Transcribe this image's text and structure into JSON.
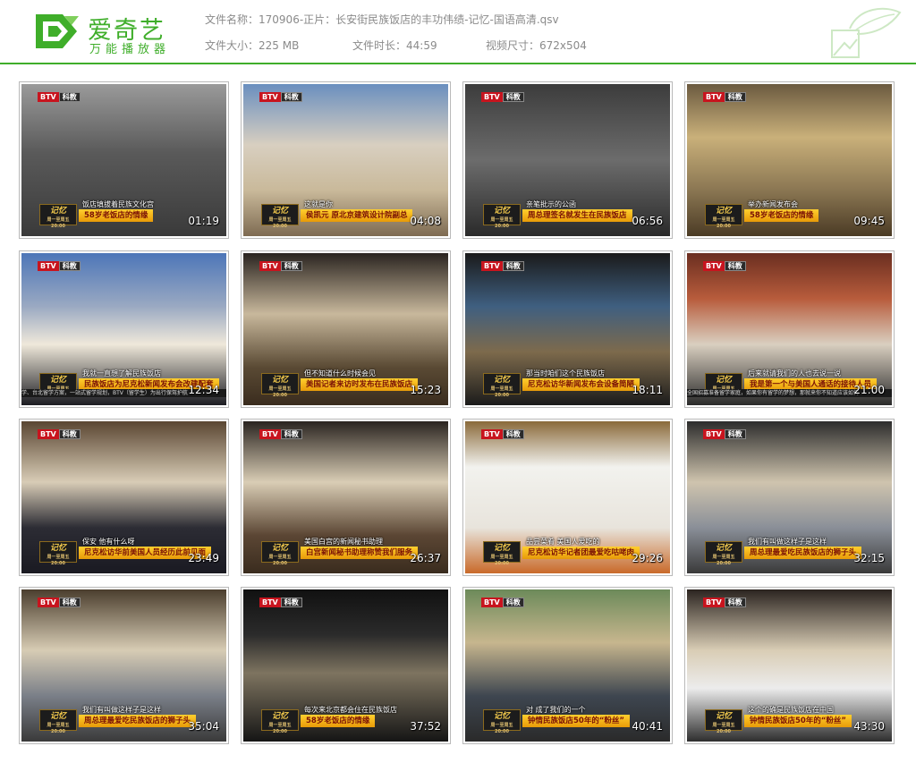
{
  "header": {
    "logo_title": "爱奇艺",
    "logo_subtitle": "万能播放器",
    "filename_label": "文件名称：",
    "filename": "170906-正片：长安街民族饭店的丰功伟绩-记忆-国语高清.qsv",
    "filesize_label": "文件大小：",
    "filesize": "225 MB",
    "duration_label": "文件时长：",
    "duration": "44:59",
    "dimensions_label": "视频尺寸：",
    "dimensions": "672x504"
  },
  "colors": {
    "brand_green": "#3fae2a",
    "caption_bar": "#f5b21a"
  },
  "channel_badge": {
    "left": "BTV",
    "right": "科教"
  },
  "show_logo": {
    "title": "记忆",
    "subtitle": "周一至周五 20:00"
  },
  "thumbnails": [
    {
      "caption_top": "饭店填拔着民族文化宫",
      "caption_bar": "58岁老饭店的情缘",
      "timestamp": "01:19",
      "ticker": ""
    },
    {
      "caption_top": "这就是你",
      "caption_bar": "侯凯元  原北京建筑设计院副总",
      "timestamp": "04:08",
      "ticker": ""
    },
    {
      "caption_top": "亲笔批示的公函",
      "caption_bar": "周总理签名就发生在民族饭店",
      "timestamp": "06:56",
      "ticker": ""
    },
    {
      "caption_top": "举办新闻发布会",
      "caption_bar": "58岁老饭店的情缘",
      "timestamp": "09:45",
      "ticker": ""
    },
    {
      "caption_top": "我就一直想了解民族饭店",
      "caption_bar": "民族饭店为尼克松新闻发布会改建配套",
      "timestamp": "12:34",
      "ticker": "学、台北留学方案，一站式留学规划，BTV（留学生）为出行保驾护航"
    },
    {
      "caption_top": "但不知道什么时候会见",
      "caption_bar": "美国记者来访时发布在民族饭店",
      "timestamp": "15:23",
      "ticker": ""
    },
    {
      "caption_top": "那当时咱们这个民族饭店",
      "caption_bar": "尼克松访华新闻发布会设备简陋",
      "timestamp": "18:11",
      "ticker": ""
    },
    {
      "caption_top": "后来就请我们的人也去说一说",
      "caption_bar": "我是第一个与美国人通话的接待人员",
      "timestamp": "21:00",
      "ticker": "全国招募准备留学家庭，如果你有留学的梦想，那就来你不知道应该如何"
    },
    {
      "caption_top": "保安  他有什么呀",
      "caption_bar": "尼克松访华前美国人员经历此前见面",
      "timestamp": "23:49",
      "ticker": ""
    },
    {
      "caption_top": "美国白宫的新闻秘书助理",
      "caption_bar": "白宫新闻秘书助理称赞我们服务",
      "timestamp": "26:37",
      "ticker": ""
    },
    {
      "caption_top": "品尝菜肴  美国人爱吃的",
      "caption_bar": "尼克松访华记者团最爱吃咕咾肉",
      "timestamp": "29:26",
      "ticker": ""
    },
    {
      "caption_top": "我们有叫做这样子是这样",
      "caption_bar": "周总理最爱吃民族饭店的狮子头",
      "timestamp": "32:15",
      "ticker": ""
    },
    {
      "caption_top": "我们有叫做这样子是这样",
      "caption_bar": "周总理最爱吃民族饭店的狮子头",
      "timestamp": "35:04",
      "ticker": ""
    },
    {
      "caption_top": "每次来北京都会住在民族饭店",
      "caption_bar": "58岁老饭店的情缘",
      "timestamp": "37:52",
      "ticker": ""
    },
    {
      "caption_top": "对  成了我们的一个",
      "caption_bar": "钟情民族饭店50年的“粉丝”",
      "timestamp": "40:41",
      "ticker": ""
    },
    {
      "caption_top": "这个的确是民族饭店在中国",
      "caption_bar": "钟情民族饭店50年的“粉丝”",
      "timestamp": "43:30",
      "ticker": ""
    }
  ]
}
